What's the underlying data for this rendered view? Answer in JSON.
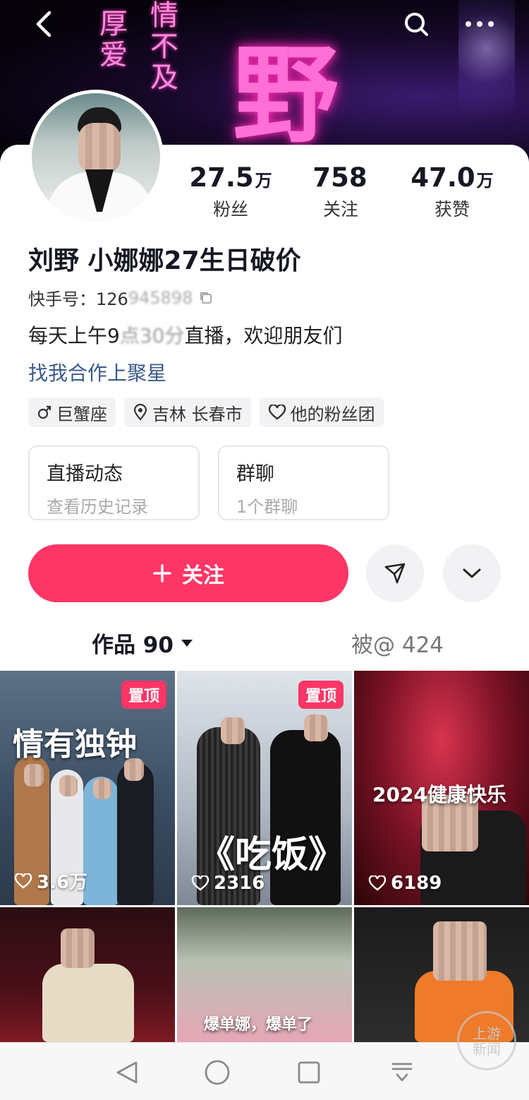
{
  "banner": {
    "big_char": "野",
    "poem_col1": "厚爱",
    "poem_col2": "情不及"
  },
  "header": {
    "back_icon": "chevron-left-icon",
    "search_icon": "search-icon",
    "more_icon": "more-horizontal-icon"
  },
  "stats": [
    {
      "num": "27.5",
      "unit": "万",
      "label": "粉丝"
    },
    {
      "num": "758",
      "unit": "",
      "label": "关注"
    },
    {
      "num": "47.0",
      "unit": "万",
      "label": "获赞"
    }
  ],
  "profile": {
    "name": "刘野 小娜娜27生日破价",
    "ks_id_label": "快手号：126",
    "ks_id_blurred": "945898",
    "bio_part1": "每天上午9",
    "bio_blurred": "点30分",
    "bio_part2": "直播，欢迎朋友们",
    "link": "找我合作上聚星"
  },
  "tags": [
    {
      "icon": "male-icon",
      "text": "巨蟹座"
    },
    {
      "icon": "location-pin-icon",
      "text": "吉林 长春市"
    },
    {
      "icon": "heart-outline-icon",
      "text": "他的粉丝团"
    }
  ],
  "tiles": [
    {
      "title": "直播动态",
      "sub": "查看历史记录"
    },
    {
      "title": "群聊",
      "sub": "1个群聊"
    }
  ],
  "actions": {
    "follow_label": "关注",
    "share_icon": "send-icon",
    "expand_icon": "chevron-down-icon"
  },
  "tabs": {
    "works_label": "作品 90",
    "mentions_label": "被@ 424"
  },
  "videos": [
    {
      "pinned": "置顶",
      "caption": "情有独钟",
      "likes": "3.6万"
    },
    {
      "pinned": "置顶",
      "caption": "《吃饭》",
      "likes": "2316"
    },
    {
      "pinned": "",
      "caption": "2024健康快乐",
      "likes": "6189"
    },
    {
      "pinned": "",
      "caption": "",
      "likes": ""
    },
    {
      "pinned": "",
      "caption": "爆单娜，爆单了",
      "likes": ""
    },
    {
      "pinned": "",
      "caption": "",
      "likes": ""
    }
  ],
  "watermark": "上游\n新闻",
  "colors": {
    "accent": "#fe3666",
    "link": "#3c5a8a",
    "text": "#161823"
  }
}
